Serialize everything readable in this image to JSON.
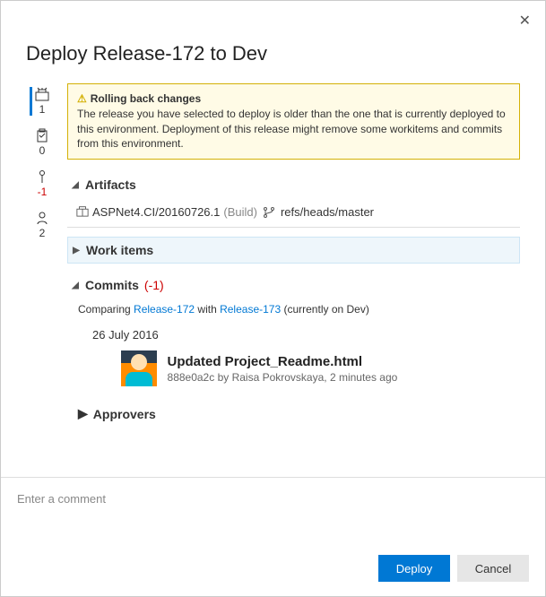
{
  "dialog": {
    "title": "Deploy Release-172 to Dev"
  },
  "sidebar": {
    "artifacts": {
      "count": "1"
    },
    "workitems": {
      "count": "0"
    },
    "commits": {
      "count": "-1"
    },
    "approvers": {
      "count": "2"
    }
  },
  "warning": {
    "title": "Rolling back changes",
    "body": "The release you have selected to deploy is older than the one that is currently deployed to this environment. Deployment of this release might remove some workitems and commits from this environment."
  },
  "sections": {
    "artifacts": {
      "label": "Artifacts",
      "item": {
        "name": "ASPNet4.CI/20160726.1",
        "type": "(Build)",
        "branch": "refs/heads/master"
      }
    },
    "workitems": {
      "label": "Work items"
    },
    "commits": {
      "label": "Commits",
      "delta": "(-1)",
      "compare_prefix": "Comparing ",
      "compare_a": "Release-172",
      "compare_mid": " with ",
      "compare_b": "Release-173",
      "compare_suffix": " (currently on Dev)",
      "date": "26 July 2016",
      "item": {
        "title": "Updated Project_Readme.html",
        "meta": "888e0a2c by Raisa Pokrovskaya, 2 minutes ago"
      }
    },
    "approvers": {
      "label": "Approvers"
    }
  },
  "comment": {
    "placeholder": "Enter a comment"
  },
  "buttons": {
    "deploy": "Deploy",
    "cancel": "Cancel"
  }
}
